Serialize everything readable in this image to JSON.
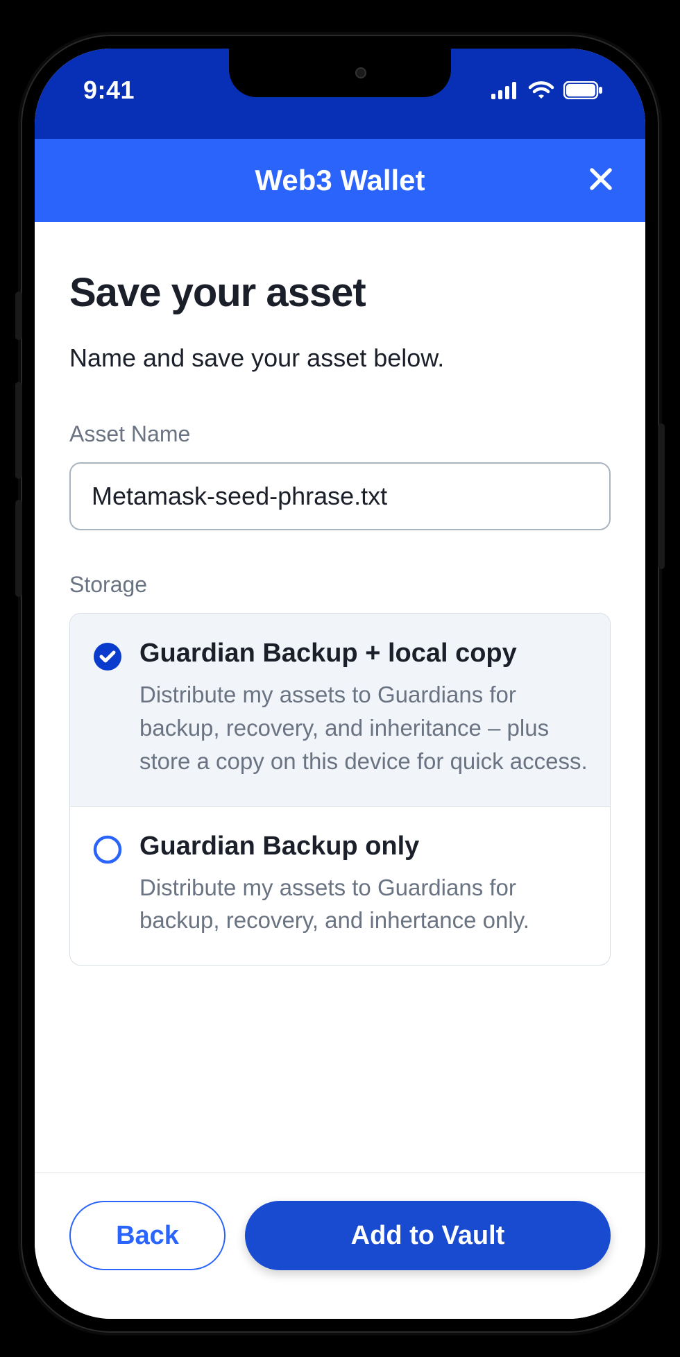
{
  "status": {
    "time": "9:41"
  },
  "header": {
    "title": "Web3 Wallet"
  },
  "page": {
    "title": "Save your asset",
    "subtitle": "Name and save your asset below."
  },
  "asset_name": {
    "label": "Asset Name",
    "value": "Metamask-seed-phrase.txt"
  },
  "storage": {
    "label": "Storage",
    "options": [
      {
        "title": "Guardian Backup + local copy",
        "description": "Distribute my assets to Guardians for backup, recovery, and inheritance – plus store a copy on this device for quick access.",
        "selected": true
      },
      {
        "title": "Guardian Backup only",
        "description": "Distribute my assets to Guardians for backup, recovery, and inhertance only.",
        "selected": false
      }
    ]
  },
  "footer": {
    "back": "Back",
    "primary": "Add to Vault"
  }
}
